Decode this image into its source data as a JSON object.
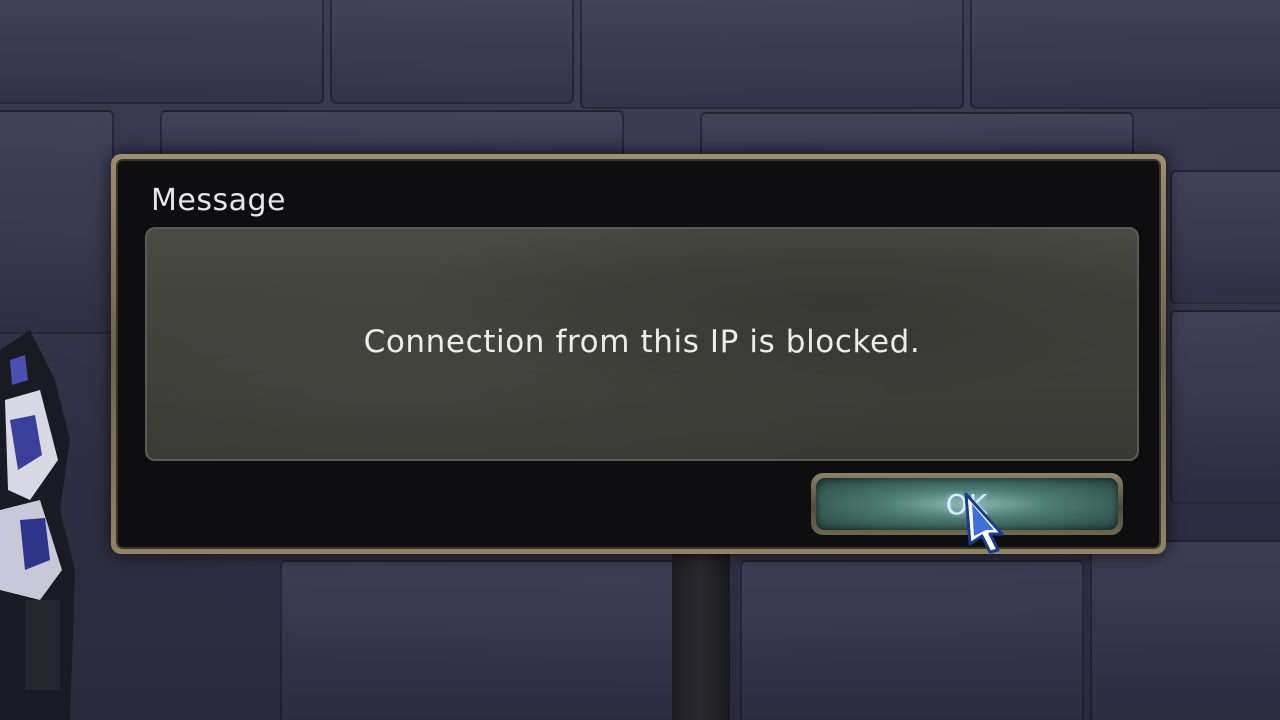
{
  "dialog": {
    "title": "Message",
    "message": "Connection from this IP is blocked.",
    "ok_label": "OK"
  },
  "icons": {
    "cursor": "pointer-cursor-icon"
  },
  "colors": {
    "frame": "#8f8464",
    "panel": "#3f3f3a",
    "button_glow": "#8fb9b0",
    "text": "#ececec"
  }
}
